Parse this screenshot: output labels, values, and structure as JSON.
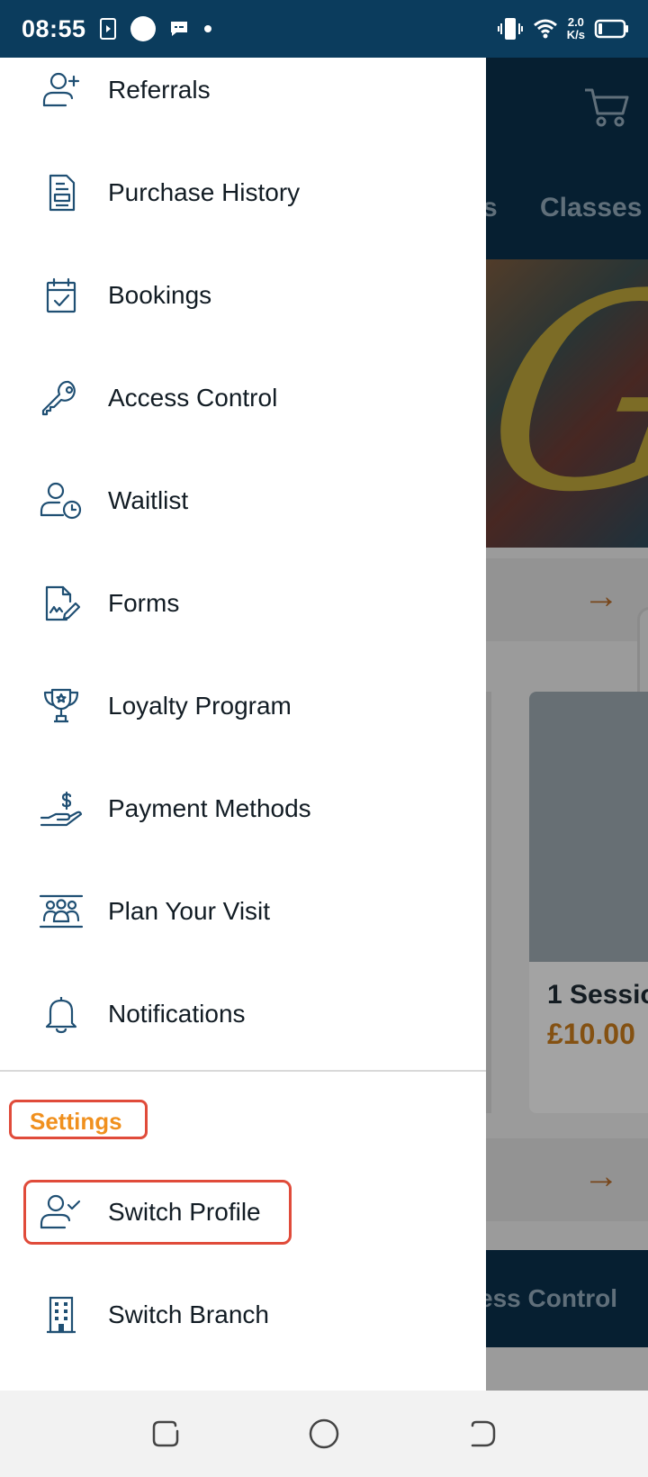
{
  "status_bar": {
    "time": "08:55",
    "net_speed_value": "2.0",
    "net_speed_unit": "K/s"
  },
  "drawer": {
    "items": [
      {
        "label": "Referrals",
        "icon": "person-add-icon"
      },
      {
        "label": "Purchase History",
        "icon": "receipt-icon"
      },
      {
        "label": "Bookings",
        "icon": "calendar-check-icon"
      },
      {
        "label": "Access Control",
        "icon": "key-icon"
      },
      {
        "label": "Waitlist",
        "icon": "person-clock-icon"
      },
      {
        "label": "Forms",
        "icon": "document-signature-icon"
      },
      {
        "label": "Loyalty Program",
        "icon": "trophy-icon"
      },
      {
        "label": "Payment Methods",
        "icon": "hand-dollar-icon"
      },
      {
        "label": "Plan Your Visit",
        "icon": "group-icon"
      },
      {
        "label": "Notifications",
        "icon": "bell-icon"
      }
    ],
    "settings_title": "Settings",
    "settings_items": [
      {
        "label": "Switch Profile",
        "icon": "person-check-icon"
      },
      {
        "label": "Switch Branch",
        "icon": "building-icon"
      }
    ]
  },
  "background": {
    "tab_partial_left": "s",
    "tab_classes": "Classes",
    "card_title": "1 Sessio",
    "card_price": "£10.00",
    "bottom_nav_label": "ess Control"
  },
  "colors": {
    "primary": "#0b3c5d",
    "icon": "#1f4f73",
    "accent_orange": "#f0901e",
    "highlight_red": "#e04b3a"
  }
}
